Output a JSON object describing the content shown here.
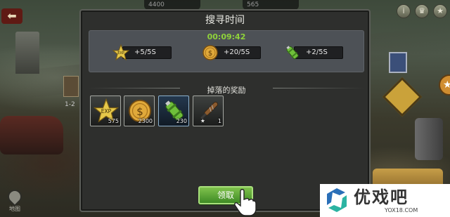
{
  "background": {
    "top_resources": [
      "4400",
      "565"
    ],
    "unit_label": "1-2",
    "top_buttons": [
      "i",
      "♛",
      "★"
    ],
    "map_label": "地图"
  },
  "dialog": {
    "title": "搜寻时间",
    "timer": "00:09:42",
    "rates": [
      {
        "icon": "exp-star-icon",
        "label": "+5/5S"
      },
      {
        "icon": "gold-coin-icon",
        "label": "+20/5S"
      },
      {
        "icon": "fuel-canister-icon",
        "label": "+2/5S"
      }
    ],
    "drops_header": "掉落的奖励",
    "drops": [
      {
        "icon": "exp-star-icon",
        "count": "575"
      },
      {
        "icon": "gold-coin-icon",
        "count": "2300"
      },
      {
        "icon": "fuel-canister-icon",
        "count": "230"
      },
      {
        "icon": "baseball-bat-icon",
        "count": "1"
      }
    ],
    "claim_button": "领取"
  },
  "watermark": {
    "name": "优戏吧",
    "url": "YOX18.COM"
  },
  "colors": {
    "timer": "#8fd23a",
    "claim_button": "#5ea637",
    "dialog_bg": "#2e2f2d",
    "panel_bg": "#4d5156"
  }
}
